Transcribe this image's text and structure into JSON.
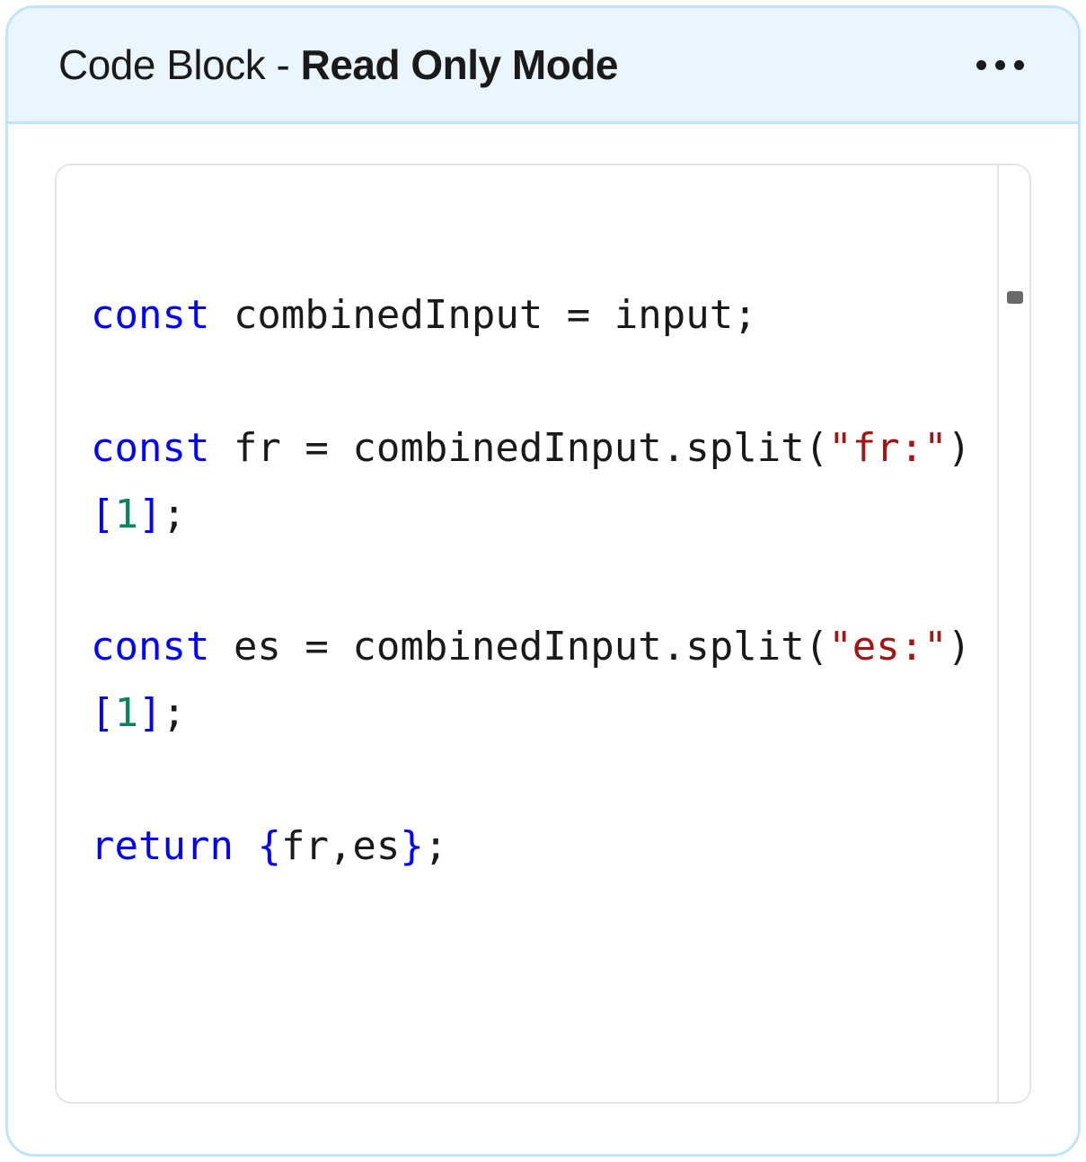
{
  "header": {
    "title_prefix": "Code Block - ",
    "title_bold": "Read Only Mode",
    "more_button_aria": "More options"
  },
  "code": {
    "tokens": [
      {
        "cls": "",
        "text": "\n"
      },
      {
        "cls": "tk-kw",
        "text": "const"
      },
      {
        "cls": "",
        "text": " combinedInput = input;"
      },
      {
        "cls": "",
        "text": "\n\n"
      },
      {
        "cls": "tk-kw",
        "text": "const"
      },
      {
        "cls": "",
        "text": " fr = combinedInput.split"
      },
      {
        "cls": "",
        "text": "("
      },
      {
        "cls": "tk-str",
        "text": "\"fr:\""
      },
      {
        "cls": "",
        "text": ")"
      },
      {
        "cls": "tk-punc-blue",
        "text": "["
      },
      {
        "cls": "tk-num",
        "text": "1"
      },
      {
        "cls": "tk-punc-blue",
        "text": "]"
      },
      {
        "cls": "",
        "text": ";"
      },
      {
        "cls": "",
        "text": "\n\n"
      },
      {
        "cls": "tk-kw",
        "text": "const"
      },
      {
        "cls": "",
        "text": " es = combinedInput.split"
      },
      {
        "cls": "",
        "text": "("
      },
      {
        "cls": "tk-str",
        "text": "\"es:\""
      },
      {
        "cls": "",
        "text": ")"
      },
      {
        "cls": "tk-punc-blue",
        "text": "["
      },
      {
        "cls": "tk-num",
        "text": "1"
      },
      {
        "cls": "tk-punc-blue",
        "text": "]"
      },
      {
        "cls": "",
        "text": ";"
      },
      {
        "cls": "",
        "text": "\n\n"
      },
      {
        "cls": "tk-kw",
        "text": "return"
      },
      {
        "cls": "",
        "text": " "
      },
      {
        "cls": "tk-punc-blue",
        "text": "{"
      },
      {
        "cls": "",
        "text": "fr,es"
      },
      {
        "cls": "tk-punc-blue",
        "text": "}"
      },
      {
        "cls": "",
        "text": ";"
      }
    ]
  }
}
